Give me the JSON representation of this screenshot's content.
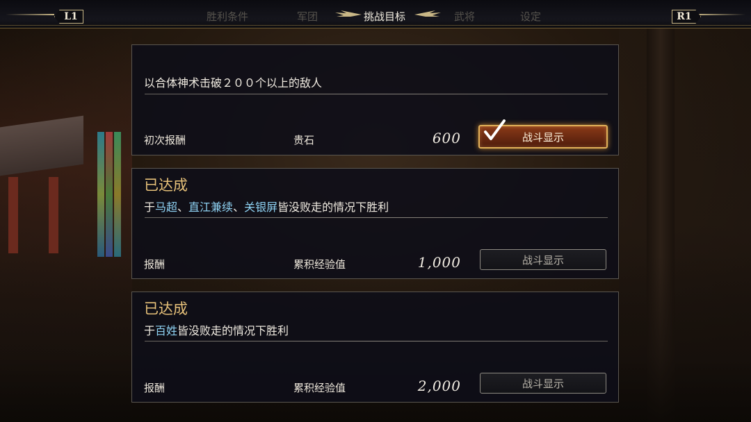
{
  "topbar": {
    "l1": "L1",
    "r1": "R1",
    "tabs": [
      "胜利条件",
      "军团",
      "挑战目标",
      "武将",
      "设定"
    ],
    "active_tab": "挑战目标"
  },
  "objectives": [
    {
      "status": "",
      "text_parts": [
        {
          "t": "以合体神术击破２００个以上的敌人",
          "hl": false
        }
      ],
      "reward_label": "初次报酬",
      "reward_item": "贵石",
      "reward_value": "600",
      "button_label": "战斗显示",
      "button_on": true
    },
    {
      "status": "已达成",
      "text_parts": [
        {
          "t": "于",
          "hl": false
        },
        {
          "t": "马超",
          "hl": true
        },
        {
          "t": "、",
          "hl": false
        },
        {
          "t": "直江兼续",
          "hl": true
        },
        {
          "t": "、",
          "hl": false
        },
        {
          "t": "关银屏",
          "hl": true
        },
        {
          "t": "皆没败走的情况下胜利",
          "hl": false
        }
      ],
      "reward_label": "报酬",
      "reward_item": "累积经验值",
      "reward_value": "1,000",
      "button_label": "战斗显示",
      "button_on": false
    },
    {
      "status": "已达成",
      "text_parts": [
        {
          "t": "于",
          "hl": false
        },
        {
          "t": "百姓",
          "hl": true
        },
        {
          "t": "皆没败走的情况下胜利",
          "hl": false
        }
      ],
      "reward_label": "报酬",
      "reward_item": "累积经验值",
      "reward_value": "2,000",
      "button_label": "战斗显示",
      "button_on": false
    }
  ],
  "colors": {
    "highlight": "#8fd3f4",
    "achieved": "#e8c27a",
    "gold": "#c9b786"
  }
}
